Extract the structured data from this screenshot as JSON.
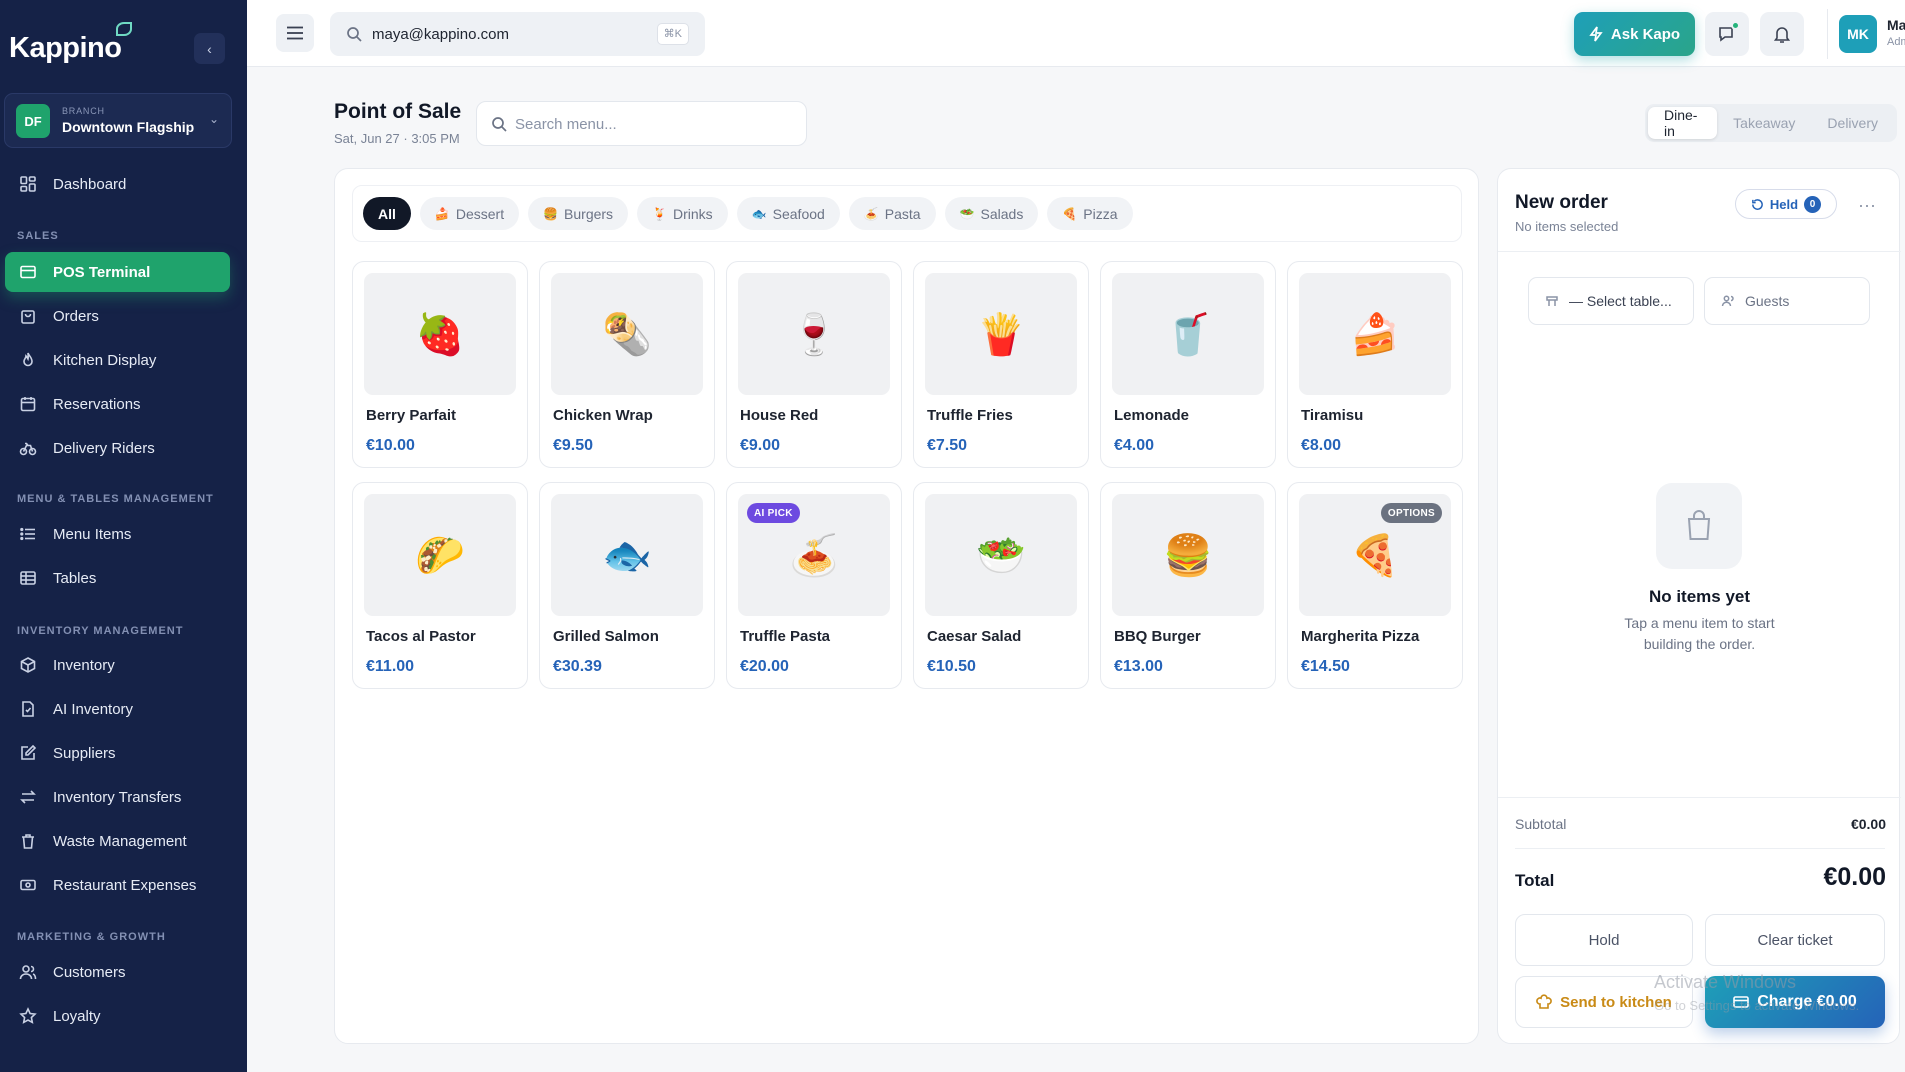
{
  "app": {
    "logo": "Kappino"
  },
  "branch": {
    "avatar": "DF",
    "kicker": "BRANCH",
    "name": "Downtown Flagship"
  },
  "sidebar": {
    "sections": [
      "SALES",
      "MENU & TABLES MANAGEMENT",
      "INVENTORY MANAGEMENT",
      "MARKETING & GROWTH"
    ],
    "items": [
      {
        "label": "Dashboard",
        "icon": "grid-icon"
      },
      {
        "label": "POS Terminal",
        "icon": "card-icon",
        "active": true
      },
      {
        "label": "Orders",
        "icon": "bag-icon"
      },
      {
        "label": "Kitchen Display",
        "icon": "flame-icon"
      },
      {
        "label": "Reservations",
        "icon": "calendar-icon"
      },
      {
        "label": "Delivery Riders",
        "icon": "bike-icon"
      },
      {
        "label": "Menu Items",
        "icon": "list-icon"
      },
      {
        "label": "Tables",
        "icon": "table-icon"
      },
      {
        "label": "Inventory",
        "icon": "box-icon"
      },
      {
        "label": "AI Inventory",
        "icon": "doc-icon"
      },
      {
        "label": "Suppliers",
        "icon": "edit-icon"
      },
      {
        "label": "Inventory Transfers",
        "icon": "transfer-icon"
      },
      {
        "label": "Waste Management",
        "icon": "trash-icon"
      },
      {
        "label": "Restaurant Expenses",
        "icon": "money-icon"
      },
      {
        "label": "Customers",
        "icon": "users-icon"
      },
      {
        "label": "Loyalty",
        "icon": "star-icon"
      }
    ]
  },
  "topbar": {
    "search_value": "maya@kappino.com",
    "shortcut": "⌘K",
    "ask_label": "Ask Kapo",
    "user_initials": "MK",
    "user_name": "Maya",
    "user_role": "Admin"
  },
  "page": {
    "title": "Point of Sale",
    "date": "Sat, Jun 27 · 3:05 PM",
    "search_placeholder": "Search menu...",
    "modes": [
      "Dine-in",
      "Takeaway",
      "Delivery"
    ],
    "active_mode": "Dine-in"
  },
  "categories": [
    {
      "label": "All",
      "emoji": ""
    },
    {
      "label": "Dessert",
      "emoji": "🍰"
    },
    {
      "label": "Burgers",
      "emoji": "🍔"
    },
    {
      "label": "Drinks",
      "emoji": "🍹"
    },
    {
      "label": "Seafood",
      "emoji": "🐟"
    },
    {
      "label": "Pasta",
      "emoji": "🍝"
    },
    {
      "label": "Salads",
      "emoji": "🥗"
    },
    {
      "label": "Pizza",
      "emoji": "🍕"
    }
  ],
  "menu_items": [
    {
      "name": "Berry Parfait",
      "price": "€10.00",
      "emoji": "🍓",
      "badge": ""
    },
    {
      "name": "Chicken Wrap",
      "price": "€9.50",
      "emoji": "🌯",
      "badge": ""
    },
    {
      "name": "House Red",
      "price": "€9.00",
      "emoji": "🍷",
      "badge": ""
    },
    {
      "name": "Truffle Fries",
      "price": "€7.50",
      "emoji": "🍟",
      "badge": ""
    },
    {
      "name": "Lemonade",
      "price": "€4.00",
      "emoji": "🥤",
      "badge": ""
    },
    {
      "name": "Tiramisu",
      "price": "€8.00",
      "emoji": "🍰",
      "badge": ""
    },
    {
      "name": "Tacos al Pastor",
      "price": "€11.00",
      "emoji": "🌮",
      "badge": ""
    },
    {
      "name": "Grilled Salmon",
      "price": "€30.39",
      "emoji": "🐟",
      "badge": ""
    },
    {
      "name": "Truffle Pasta",
      "price": "€20.00",
      "emoji": "🍝",
      "badge": "AI PICK"
    },
    {
      "name": "Caesar Salad",
      "price": "€10.50",
      "emoji": "🥗",
      "badge": ""
    },
    {
      "name": "BBQ Burger",
      "price": "€13.00",
      "emoji": "🍔",
      "badge": ""
    },
    {
      "name": "Margherita Pizza",
      "price": "€14.50",
      "emoji": "🍕",
      "badge": "OPTIONS"
    }
  ],
  "order": {
    "title": "New order",
    "subtitle": "No items selected",
    "held_label": "Held",
    "held_count": "0",
    "table_placeholder": "— Select table...",
    "guests_label": "Guests",
    "empty_title": "No items yet",
    "empty_text": "Tap a menu item to start building the order.",
    "subtotal_label": "Subtotal",
    "subtotal": "€0.00",
    "total_label": "Total",
    "total": "€0.00",
    "hold_label": "Hold",
    "clear_label": "Clear ticket",
    "send_label": "Send to kitchen",
    "charge_label": "Charge €0.00"
  },
  "watermark": {
    "line1": "Activate Windows",
    "line2": "Go to Settings to activate Windows."
  },
  "colors": {
    "sidebar": "#152247",
    "accent_green": "#1fa36c",
    "accent_blue": "#2563b8",
    "ai_badge": "#6d4ae0"
  }
}
